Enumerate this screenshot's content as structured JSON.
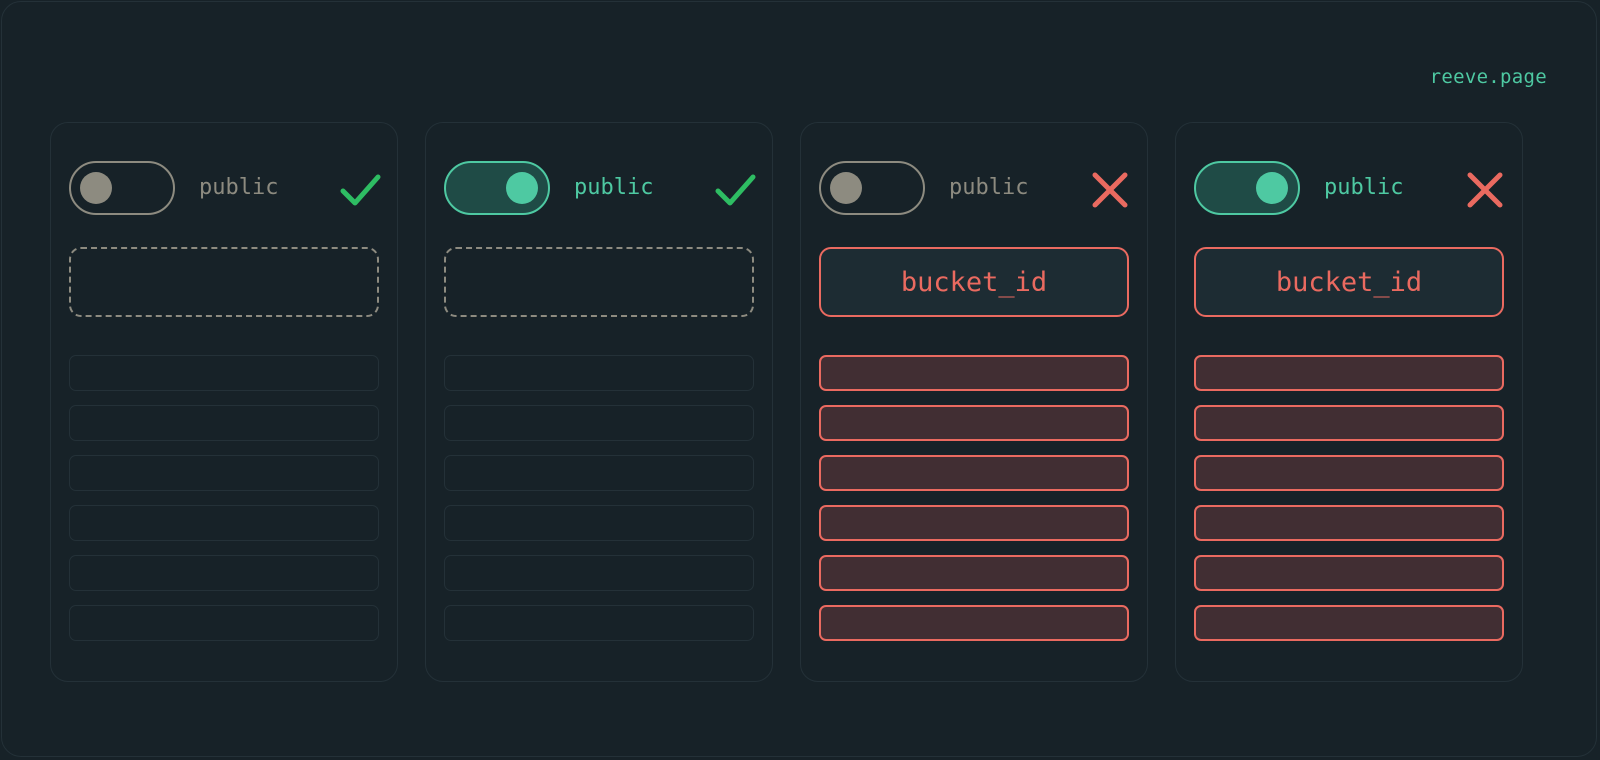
{
  "brand": "reeve.page",
  "colors": {
    "background": "#172228",
    "accent": "#4ec9a2",
    "muted": "#8d8b80",
    "success": "#2ebd63",
    "error": "#ea6a60"
  },
  "panels": [
    {
      "toggle_state": "off",
      "toggle_label": "public",
      "status_icon": "check-icon",
      "slot_state": "empty",
      "slot_text": "",
      "row_state": "muted",
      "row_count": 6
    },
    {
      "toggle_state": "on",
      "toggle_label": "public",
      "status_icon": "check-icon",
      "slot_state": "empty",
      "slot_text": "",
      "row_state": "muted",
      "row_count": 6
    },
    {
      "toggle_state": "off",
      "toggle_label": "public",
      "status_icon": "x-icon",
      "slot_state": "filled",
      "slot_text": "bucket_id",
      "row_state": "error",
      "row_count": 6
    },
    {
      "toggle_state": "on",
      "toggle_label": "public",
      "status_icon": "x-icon",
      "slot_state": "filled",
      "slot_text": "bucket_id",
      "row_state": "error",
      "row_count": 6
    }
  ]
}
